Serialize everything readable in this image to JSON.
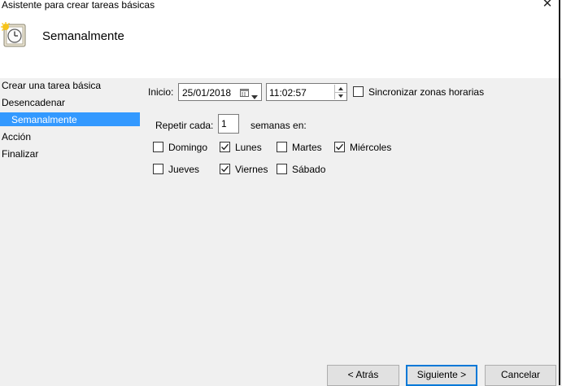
{
  "window": {
    "title": "Asistente para crear tareas básicas"
  },
  "header": {
    "title": "Semanalmente",
    "icon": "task-clock-icon"
  },
  "nav": {
    "items": [
      {
        "label": "Crear una tarea básica",
        "selected": false
      },
      {
        "label": "Desencadenar",
        "selected": false
      },
      {
        "label": "Semanalmente",
        "selected": true
      },
      {
        "label": "Acción",
        "selected": false
      },
      {
        "label": "Finalizar",
        "selected": false
      }
    ],
    "selected_color": "#3399ff"
  },
  "form": {
    "start_label": "Inicio:",
    "date_value": "25/01/2018",
    "time_value": "11:02:57",
    "sync_label": "Sincronizar zonas horarias",
    "sync_checked": false,
    "repeat_label": "Repetir cada:",
    "repeat_value": "1",
    "weeks_label": "semanas en:",
    "days": [
      {
        "label": "Domingo",
        "checked": false
      },
      {
        "label": "Lunes",
        "checked": true
      },
      {
        "label": "Martes",
        "checked": false
      },
      {
        "label": "Miércoles",
        "checked": true
      },
      {
        "label": "Jueves",
        "checked": false
      },
      {
        "label": "Viernes",
        "checked": true
      },
      {
        "label": "Sábado",
        "checked": false
      }
    ]
  },
  "buttons": {
    "back": "< Atrás",
    "next": "Siguiente >",
    "cancel": "Cancelar"
  }
}
